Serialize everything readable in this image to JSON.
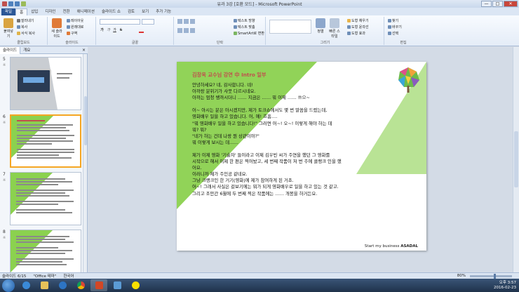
{
  "window": {
    "title": "유과 3강 [호환 모드] - Microsoft PowerPoint",
    "minimize": "—",
    "maximize": "□",
    "close": "✕"
  },
  "tabs": [
    "파일",
    "홈",
    "삽입",
    "디자인",
    "전환",
    "애니메이션",
    "슬라이드 쇼",
    "검토",
    "보기",
    "추가 기능"
  ],
  "ribbon": {
    "clipboard": {
      "label": "클립보드",
      "paste": "붙여넣기",
      "cut": "잘라내기",
      "copy": "복사",
      "format_painter": "서식 복사"
    },
    "slides": {
      "label": "슬라이드",
      "new_slide": "새 슬라이드",
      "layout": "레이아웃",
      "reset": "원래대로",
      "section": "구역"
    },
    "font": {
      "label": "글꼴",
      "bold": "가",
      "italic": "가",
      "underline": "가",
      "strike": "S"
    },
    "paragraph": {
      "label": "단락",
      "text_direction": "텍스트 방향",
      "align_text": "텍스트 맞춤",
      "smartart": "SmartArt로 변환"
    },
    "drawing": {
      "label": "그리기",
      "arrange": "정렬",
      "quick_styles": "빠른 스타일",
      "fill": "도형 채우기",
      "outline": "도형 윤곽선",
      "effects": "도형 효과"
    },
    "editing": {
      "label": "편집",
      "find": "찾기",
      "replace": "바꾸기",
      "select": "선택"
    }
  },
  "panel": {
    "tab_slides": "슬라이드",
    "tab_outline": "개요",
    "close": "×"
  },
  "thumbnails": [
    {
      "num": "5",
      "star": "※"
    },
    {
      "num": "6",
      "star": "※"
    },
    {
      "num": "7",
      "star": "※"
    },
    {
      "num": "8",
      "star": "※"
    }
  ],
  "slide": {
    "title": "김창욱 교수님 강연 中 Intro 일부",
    "paragraphs": [
      [
        "안녕하세요? 네, 감사합니다. 네!",
        "아까랑 분위기가 사뭇 다르시네요.",
        "아까는 엄청 쌩까시더니 …… 지금은 …… 뭐 이제 …… 쓰으~"
      ],
      [
        "어~ 아시는 분은 아시겠지만, 제가 토크쇼에서도 몇 번 말씀을 드렸는데,",
        "영화배우 일을 하고 있습니다. 어, 예! 흐흠….",
        "\"뭐 영화배우 일을 하고 있습니다!\"  그러면 어~! 오~! 이렇게 해야 하는 데",
        "뭐? 뭐?",
        "  \"네가 하는 건데 나랑 뭔 상관이야?\"",
        "뭐 이렇게 보시는 데……"
      ],
      [
        "제가 이제 영화  '기술자' 들이라고 이제 김우빈 씨가 주연을 했던 그 영화를",
        "시작으로 해서 이제 한 편은 찍어놨고, 세 번째 작품이 저 번 주에 클랭크 인을 했",
        "어요.",
        "이러니까 제가 주인공 같네요.",
        "그냥 크랭크인 한 거기(영화)에 제가 참여하게 된 거죠.",
        "어~! 그래서 사실은 겉보기에는 뭐가 되게 영화배우로 일을 하고 있는 것 같고.",
        "그리고 조만간 6월에 두 번째 찍은 작품에는 …… 개봉을 하거든요."
      ]
    ],
    "footer_prefix": "Start my business ",
    "footer_brand": "ASADAL"
  },
  "status": {
    "slide_info": "슬라이드 6/15",
    "theme": "\"Office 테마\"",
    "language": "한국어",
    "zoom": "80%"
  },
  "taskbar": {
    "time": "오후 3:57",
    "date": "2016-02-23"
  },
  "colors": {
    "accent_green": "#8bd14f",
    "title_red": "#c0504d",
    "file_tab": "#2b5797"
  }
}
